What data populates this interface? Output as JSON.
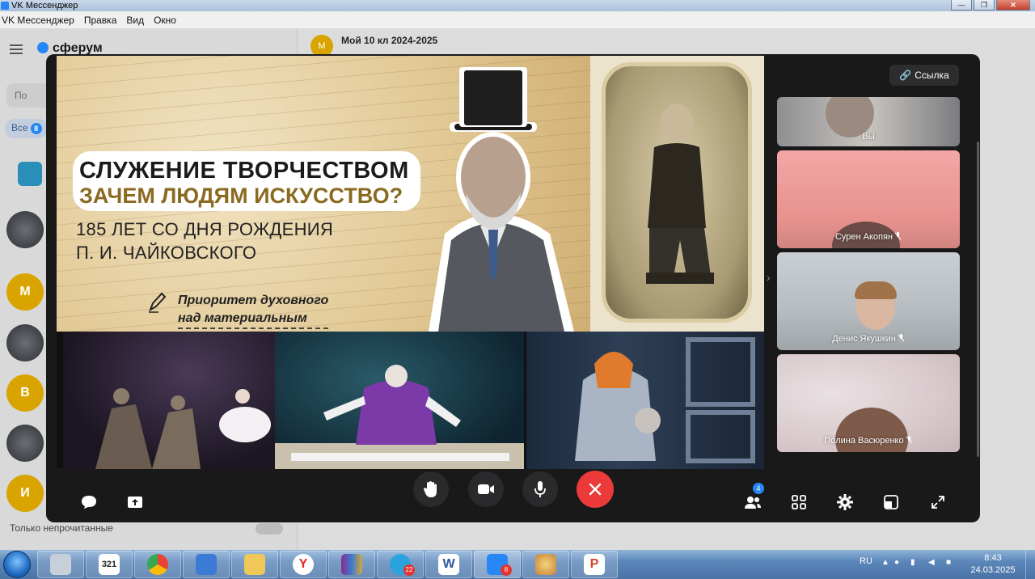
{
  "window": {
    "title": "VK Мессенджер",
    "menu": [
      "Правка",
      "Вид",
      "Окно"
    ],
    "minimize": "—",
    "maximize": "❐",
    "close": "✕"
  },
  "messenger": {
    "logo": "сферум",
    "search_placeholder": "По",
    "filter_pill": "Все",
    "filter_badge": "8",
    "avatar_letters": [
      "М",
      "В",
      "И"
    ],
    "chat_title": "Мой 10 кл 2024-2025",
    "chat_avatar_letter": "М",
    "unread_toggle_label": "Только непрочитанные"
  },
  "call": {
    "link_button": "Ссылка",
    "banner": {
      "title_line1": "СЛУЖЕНИЕ ТВОРЧЕСТВОМ",
      "title_line2": "ЗАЧЕМ ЛЮДЯМ ИСКУССТВО?",
      "subtitle_line1": "185 ЛЕТ СО ДНЯ РОЖДЕНИЯ",
      "subtitle_line2": "П. И. ЧАЙКОВСКОГО",
      "priority_line1": "Приоритет духовного",
      "priority_line2": "над материальным"
    },
    "participants": [
      {
        "name": "Вы",
        "muted": false
      },
      {
        "name": "Сурен Акопян",
        "muted": true
      },
      {
        "name": "Денис Якушкин",
        "muted": true
      },
      {
        "name": "Полина Васюренко",
        "muted": true
      }
    ],
    "participants_badge": "4",
    "controls": {
      "left": [
        "chat-icon",
        "share-screen-icon"
      ],
      "center": [
        "raise-hand-icon",
        "camera-icon",
        "microphone-icon",
        "hang-up-icon"
      ],
      "right": [
        "participants-icon",
        "grid-icon",
        "settings-icon",
        "layout-icon",
        "fullscreen-icon"
      ]
    }
  },
  "taskbar": {
    "apps": [
      {
        "name": "calculator",
        "badge": ""
      },
      {
        "name": "calendar",
        "label": "321",
        "badge": ""
      },
      {
        "name": "chrome",
        "badge": ""
      },
      {
        "name": "computer",
        "badge": ""
      },
      {
        "name": "explorer",
        "badge": ""
      },
      {
        "name": "yandex",
        "label": "Y",
        "badge": ""
      },
      {
        "name": "winrar",
        "badge": ""
      },
      {
        "name": "telegram",
        "badge": "22"
      },
      {
        "name": "word",
        "label": "W",
        "badge": ""
      },
      {
        "name": "vk-messenger",
        "badge": "8"
      },
      {
        "name": "paint",
        "badge": ""
      },
      {
        "name": "powerpoint",
        "label": "P",
        "badge": ""
      }
    ],
    "language": "RU",
    "time": "8:43",
    "date": "24.03.2025"
  },
  "colors": {
    "accent": "#2787f5",
    "hang_up": "#ec3a3a",
    "call_bg": "#19191a"
  }
}
